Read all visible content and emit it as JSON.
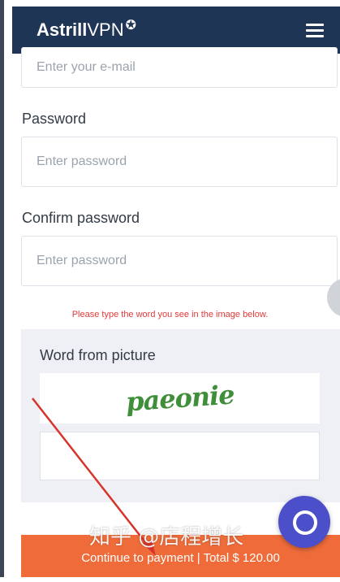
{
  "header": {
    "logo_bold": "Astrill",
    "logo_light": "VPN",
    "logo_mark": "✪",
    "menu_icon": "hamburger-icon"
  },
  "form": {
    "email_placeholder": "Enter your e-mail",
    "password_label": "Password",
    "password_placeholder": "Enter password",
    "confirm_label": "Confirm password",
    "confirm_placeholder": "Enter password"
  },
  "captcha": {
    "hint": "Please type the word you see in the image below.",
    "label": "Word from picture",
    "word": "paeonie"
  },
  "submit_label": "Continue to payment | Total $ 120.00",
  "watermark": "知乎 @店程增长",
  "colors": {
    "header": "#1f3556",
    "accent": "#ef6c3a",
    "hint": "#e03a3a",
    "chat": "#4b4fc9",
    "arrow": "#d8352a"
  }
}
